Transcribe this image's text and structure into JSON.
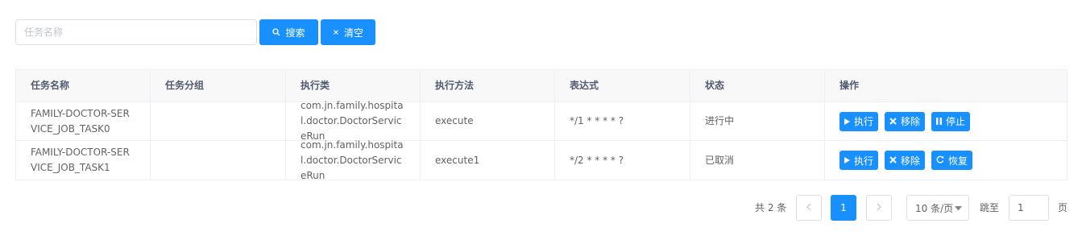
{
  "search": {
    "placeholder": "任务名称",
    "value": "",
    "search_label": "搜索",
    "search_icon": "search-icon",
    "clear_label": "清空",
    "clear_icon": "close-icon"
  },
  "table": {
    "headers": [
      "任务名称",
      "任务分组",
      "执行类",
      "执行方法",
      "表达式",
      "状态",
      "操作"
    ],
    "rows": [
      {
        "name": "FAMILY-DOCTOR-SERVICE_JOB_TASK0",
        "group": "",
        "class": "com.jn.family.hospital.doctor.DoctorServiceRun",
        "method": "execute",
        "cron": "*/1 * * * * ?",
        "status": "进行中",
        "actions": [
          {
            "label": "执行",
            "icon": "play-icon"
          },
          {
            "label": "移除",
            "icon": "close-icon"
          },
          {
            "label": "停止",
            "icon": "pause-icon"
          }
        ]
      },
      {
        "name": "FAMILY-DOCTOR-SERVICE_JOB_TASK1",
        "group": "",
        "class": "com.jn.family.hospital.doctor.DoctorServiceRun",
        "method": "execute1",
        "cron": "*/2 * * * * ?",
        "status": "已取消",
        "actions": [
          {
            "label": "执行",
            "icon": "play-icon"
          },
          {
            "label": "移除",
            "icon": "close-icon"
          },
          {
            "label": "恢复",
            "icon": "refresh-icon"
          }
        ]
      }
    ]
  },
  "pagination": {
    "total_text": "共 2 条",
    "current_page": "1",
    "page_size": "10 条/页",
    "jump_label": "跳至",
    "jump_value": "1",
    "page_unit": "页"
  },
  "colors": {
    "primary": "#1890ff",
    "header_bg": "#f8f8f9",
    "border": "#ebeef5"
  }
}
